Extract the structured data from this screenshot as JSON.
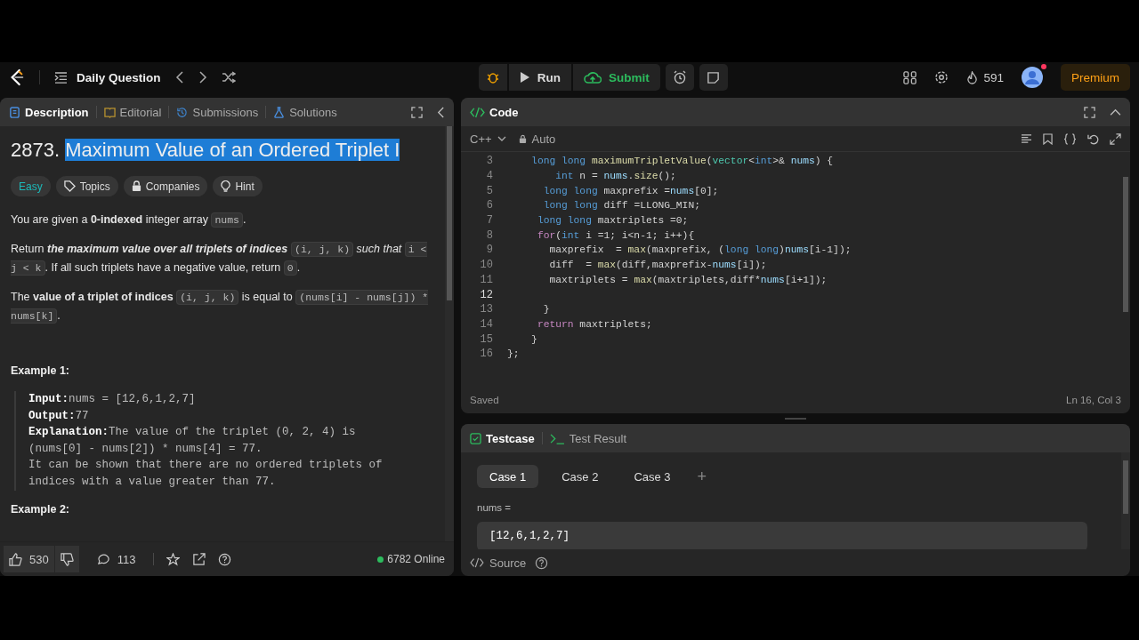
{
  "topbar": {
    "title": "Daily Question",
    "run": "Run",
    "submit": "Submit",
    "streak": "591",
    "premium": "Premium",
    "notification": true
  },
  "description_panel": {
    "tabs": [
      {
        "label": "Description",
        "selected": true,
        "kind": "doc"
      },
      {
        "label": "Editorial",
        "selected": false,
        "kind": "book"
      },
      {
        "label": "Submissions",
        "selected": false,
        "kind": "history"
      },
      {
        "label": "Solutions",
        "selected": false,
        "kind": "flask"
      }
    ],
    "title": {
      "number": "2873.",
      "text": "Maximum Value of an Ordered Triplet I",
      "highlighted": true
    },
    "tags": [
      {
        "label": "Easy",
        "kind": "difficulty"
      },
      {
        "label": "Topics",
        "kind": "tag"
      },
      {
        "label": "Companies",
        "kind": "lock"
      },
      {
        "label": "Hint",
        "kind": "bulb"
      }
    ],
    "paragraphs": [
      [
        {
          "kind": "text",
          "text": "You are given a **0-indexed** integer array "
        },
        {
          "kind": "code",
          "text": "nums"
        },
        {
          "kind": "text",
          "text": "."
        }
      ],
      [
        {
          "kind": "text",
          "text": "Return "
        },
        {
          "kind": "strong_em",
          "text": "the maximum value over all triplets of indices"
        },
        {
          "kind": "code",
          "text": "(i, j, k)"
        },
        {
          "kind": "text",
          "text": " *such that* "
        },
        {
          "kind": "code",
          "text": "i < j < k"
        },
        {
          "kind": "text",
          "text": ". If all such triplets have a negative value, return "
        },
        {
          "kind": "code",
          "text": "0"
        },
        {
          "kind": "text",
          "text": "."
        }
      ],
      [
        {
          "kind": "text",
          "text": "The **value of a triplet of indices** "
        },
        {
          "kind": "code",
          "text": "(i, j, k)"
        },
        {
          "kind": "text",
          "text": " is equal to "
        },
        {
          "kind": "code",
          "text": "(nums[i] - nums[j]) * nums[k]"
        },
        {
          "kind": "text",
          "text": "."
        }
      ]
    ],
    "examples": [
      {
        "heading": "Example 1:",
        "lines": [
          {
            "label": "Input:",
            "text": "nums = [12,6,1,2,7]"
          },
          {
            "label": "Output:",
            "text": "77"
          },
          {
            "label": "Explanation:",
            "text": "The value of the triplet (0, 2, 4) is"
          },
          {
            "text": "(nums[0] - nums[2]) * nums[4] = 77."
          },
          {
            "text": "It can be shown that there are no ordered triplets of"
          },
          {
            "text": "indices with a value greater than 77."
          }
        ]
      },
      {
        "heading": "Example 2:"
      }
    ],
    "footer": {
      "likes": "530",
      "comments": "113",
      "online": "6782 Online"
    }
  },
  "code_panel": {
    "title": "Code",
    "language": "C++",
    "mode": "Auto",
    "status": "Saved",
    "cursor": "Ln 16, Col 3",
    "lines": [
      {
        "number": "3",
        "tokens": [
          {
            "kind": "kw",
            "text": "    long long "
          },
          {
            "kind": "fn",
            "text": "maximumTripletValue"
          },
          {
            "kind": "p",
            "text": "("
          },
          {
            "kind": "type",
            "text": "vector"
          },
          {
            "kind": "p",
            "text": "<"
          },
          {
            "kind": "kw",
            "text": "int"
          },
          {
            "kind": "p",
            "text": ">& "
          },
          {
            "kind": "var",
            "text": "nums"
          },
          {
            "kind": "p",
            "text": ") {"
          }
        ]
      },
      {
        "number": "4",
        "tokens": [
          {
            "kind": "kw",
            "text": "        int"
          },
          {
            "kind": "p",
            "text": " n = "
          },
          {
            "kind": "var",
            "text": "nums"
          },
          {
            "kind": "p",
            "text": "."
          },
          {
            "kind": "fn",
            "text": "size"
          },
          {
            "kind": "p",
            "text": "();"
          }
        ]
      },
      {
        "number": "5",
        "tokens": [
          {
            "kind": "kw",
            "text": "      long long"
          },
          {
            "kind": "p",
            "text": " maxprefix ="
          },
          {
            "kind": "var",
            "text": "nums"
          },
          {
            "kind": "p",
            "text": "[0];"
          }
        ]
      },
      {
        "number": "6",
        "tokens": [
          {
            "kind": "kw",
            "text": "      long long"
          },
          {
            "kind": "p",
            "text": " diff =LLONG_MIN;"
          }
        ]
      },
      {
        "number": "7",
        "tokens": [
          {
            "kind": "kw",
            "text": "     long long"
          },
          {
            "kind": "p",
            "text": " maxtriplets =0;"
          }
        ]
      },
      {
        "number": "8",
        "tokens": [
          {
            "kind": "ctrl",
            "text": "     for"
          },
          {
            "kind": "p",
            "text": "("
          },
          {
            "kind": "kw",
            "text": "int"
          },
          {
            "kind": "p",
            "text": " i =1; i<n-1; i++){"
          }
        ]
      },
      {
        "number": "9",
        "tokens": [
          {
            "kind": "p",
            "text": "       maxprefix  = "
          },
          {
            "kind": "fn",
            "text": "max"
          },
          {
            "kind": "p",
            "text": "(maxprefix, ("
          },
          {
            "kind": "kw",
            "text": "long long"
          },
          {
            "kind": "p",
            "text": ")"
          },
          {
            "kind": "var",
            "text": "nums"
          },
          {
            "kind": "p",
            "text": "[i-1]);"
          }
        ]
      },
      {
        "number": "10",
        "tokens": [
          {
            "kind": "p",
            "text": "       diff  = "
          },
          {
            "kind": "fn",
            "text": "max"
          },
          {
            "kind": "p",
            "text": "(diff,maxprefix-"
          },
          {
            "kind": "var",
            "text": "nums"
          },
          {
            "kind": "p",
            "text": "[i]);"
          }
        ]
      },
      {
        "number": "11",
        "tokens": [
          {
            "kind": "p",
            "text": "       maxtriplets = "
          },
          {
            "kind": "fn",
            "text": "max"
          },
          {
            "kind": "p",
            "text": "(maxtriplets,diff*"
          },
          {
            "kind": "var",
            "text": "nums"
          },
          {
            "kind": "p",
            "text": "[i+1]);"
          }
        ]
      },
      {
        "number": "12"
      },
      {
        "number": "13",
        "tokens": [
          {
            "kind": "p",
            "text": "      }"
          }
        ]
      },
      {
        "number": "14",
        "tokens": [
          {
            "kind": "ctrl",
            "text": "     return"
          },
          {
            "kind": "p",
            "text": " maxtriplets;"
          }
        ]
      },
      {
        "number": "15",
        "tokens": [
          {
            "kind": "p",
            "text": "    }"
          }
        ]
      },
      {
        "number": "16",
        "tokens": [
          {
            "kind": "p",
            "text": "};"
          }
        ]
      }
    ]
  },
  "test_panel": {
    "tabs": [
      {
        "label": "Testcase",
        "selected": true
      },
      {
        "label": "Test Result",
        "selected": false
      }
    ],
    "cases": [
      {
        "label": "Case 1",
        "selected": true
      },
      {
        "label": "Case 2",
        "selected": false
      },
      {
        "label": "Case 3",
        "selected": false
      }
    ],
    "add": "+",
    "param_label": "nums =",
    "param_value": "[12,6,1,2,7]",
    "source": "Source"
  }
}
